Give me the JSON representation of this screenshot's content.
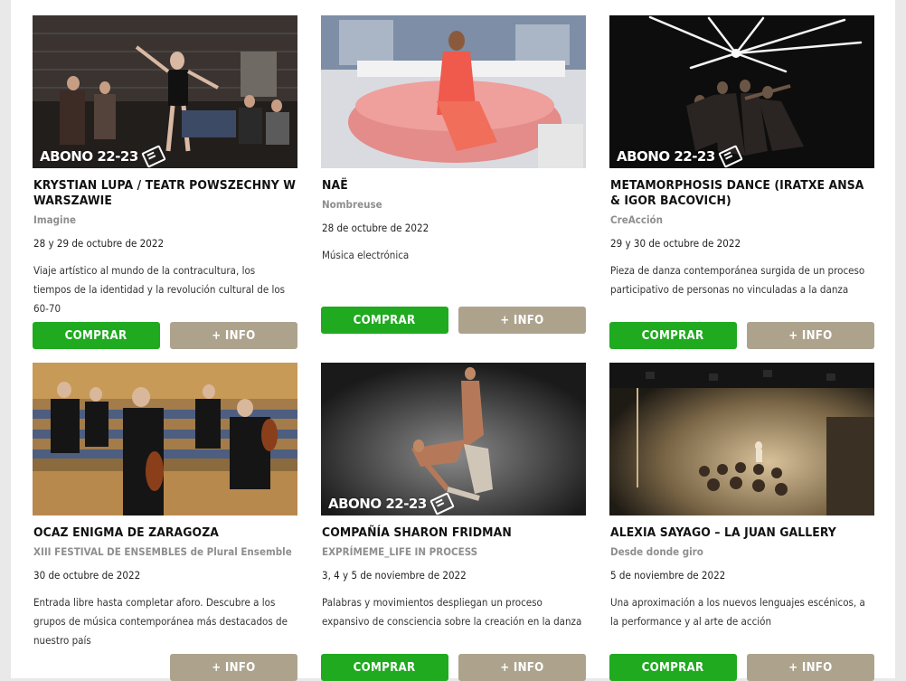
{
  "abono_label": "ABONO 22-23",
  "buy_label": "COMPRAR",
  "info_label": "+ INFO",
  "cards": [
    {
      "title": "KRYSTIAN LUPA / TEATR POWSZECHNY W WARSZAWIE",
      "subtitle": "Imagine",
      "date": "28 y 29 de octubre de 2022",
      "description": "Viaje artístico al mundo de la contracultura, los tiempos de la identidad y la revolución cultural de los 60-70"
    },
    {
      "title": "NAË",
      "subtitle": "Nombreuse",
      "date": "28 de octubre de 2022",
      "description": "Música electrónica"
    },
    {
      "title": "METAMORPHOSIS DANCE (IRATXE ANSA & IGOR BACOVICH)",
      "subtitle": "CreAcción",
      "date": "29 y 30 de octubre de 2022",
      "description": "Pieza de danza contemporánea surgida de un proceso participativo de personas no vinculadas a la danza"
    },
    {
      "title": "OCAZ ENIGMA DE ZARAGOZA",
      "subtitle": "XIII FESTIVAL DE ENSEMBLES de Plural Ensemble",
      "date": "30 de octubre de 2022",
      "description": "Entrada libre hasta completar aforo. Descubre a los grupos de música contemporánea más destacados de nuestro país"
    },
    {
      "title": "COMPAÑÍA SHARON FRIDMAN",
      "subtitle": "EXPRÍMEME_LIFE IN PROCESS",
      "date": "3, 4 y 5 de noviembre de 2022",
      "description": "Palabras y movimientos despliegan un proceso expansivo de consciencia sobre la creación en la danza"
    },
    {
      "title": "ALEXIA SAYAGO – LA JUAN GALLERY",
      "subtitle": "Desde donde giro",
      "date": "5 de noviembre de 2022",
      "description": "Una aproximación a los nuevos lenguajes escénicos, a la performance y al arte de acción"
    }
  ]
}
